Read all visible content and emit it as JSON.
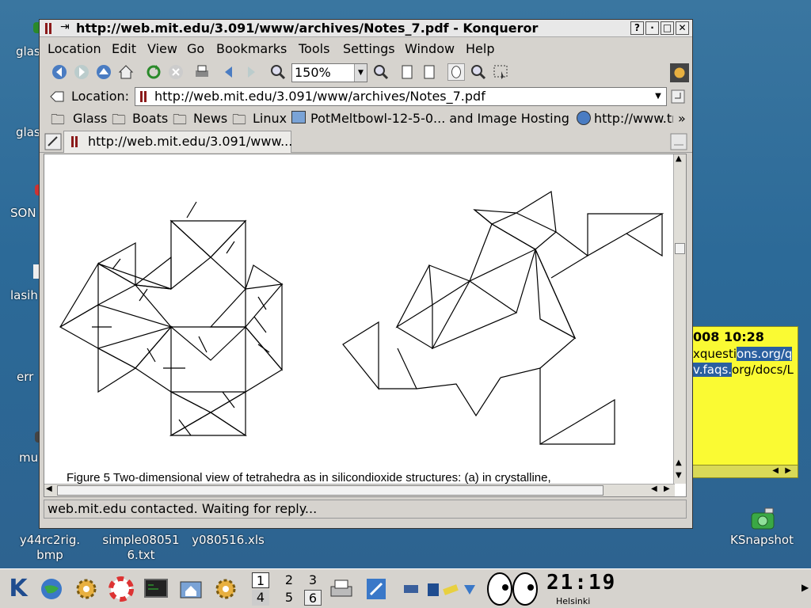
{
  "desktop": {
    "labels": [
      {
        "text": "glas",
        "name": "glas-1"
      },
      {
        "text": "glas",
        "name": "glas-2"
      },
      {
        "text": "SON",
        "name": "son"
      },
      {
        "text": "lasih",
        "name": "lasih"
      },
      {
        "text": "err",
        "name": "err"
      },
      {
        "text": "mu",
        "name": "mu"
      },
      {
        "text": "y44rc2rig.",
        "name": "file-1a"
      },
      {
        "text": "bmp",
        "name": "file-1b"
      },
      {
        "text": "simple08051",
        "name": "file-2a"
      },
      {
        "text": "6.txt",
        "name": "file-2b"
      },
      {
        "text": "y080516.xls",
        "name": "file-3"
      },
      {
        "text": "KSnapshot",
        "name": "ksnapshot"
      }
    ]
  },
  "sticky": {
    "time": "008 10:28",
    "line1_plain": "xquesti",
    "line1_highlight": "ons.org/q",
    "line2_highlight": "v.faqs.",
    "line2_plain": "org/docs/L"
  },
  "window": {
    "title": "http://web.mit.edu/3.091/www/archives/Notes_7.pdf - Konqueror",
    "buttons": {
      "help": "?",
      "minimize": "·",
      "maximize": "□",
      "close": "✕"
    },
    "menu": [
      "Location",
      "Edit",
      "View",
      "Go",
      "Bookmarks",
      "Tools",
      "Settings",
      "Window",
      "Help"
    ],
    "zoom": "150%",
    "location_label": "Location:",
    "location_url": "http://web.mit.edu/3.091/www/archives/Notes_7.pdf",
    "bookmarks": [
      "Glass",
      "Boats",
      "News",
      "Linux",
      "PotMeltbowl-12-5-0... and Image Hosting",
      "http://www.tr"
    ],
    "bookmarks_more": "»",
    "tab_label": "http://web.mit.edu/3.091/www...",
    "caption": "Figure 5   Two-dimensional view of tetrahedra as in silicondioxide structures: (a) in crystalline,",
    "status": "web.mit.edu contacted. Waiting for reply..."
  },
  "taskbar": {
    "pager": [
      "1",
      "2",
      "3",
      "4",
      "5",
      "6"
    ],
    "clock": "21:19",
    "city": "Helsinki"
  },
  "colors": {
    "desktop": "#2f6a96",
    "sticky": "#fafa33",
    "highlight": "#2a5fa0"
  }
}
